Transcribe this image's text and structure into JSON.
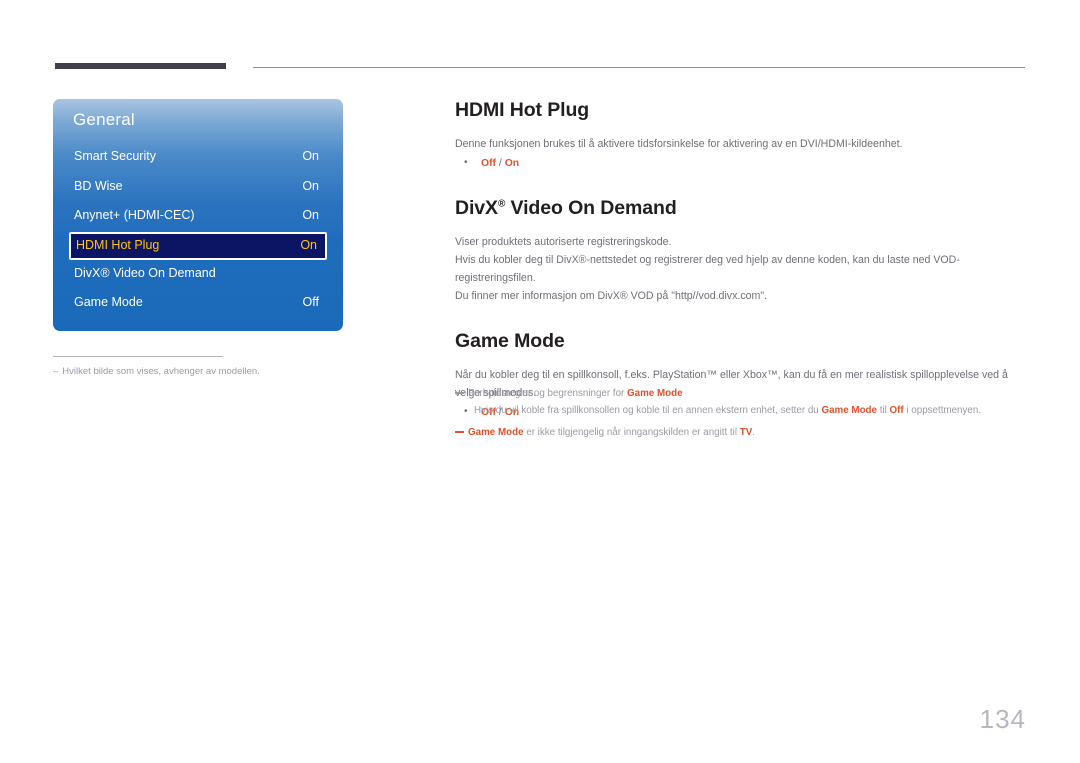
{
  "header": {
    "rule_thick": "decorative-dark-bar",
    "rule_thin": "decorative-thin-line"
  },
  "osd": {
    "title": "General",
    "items": [
      {
        "label": "Smart Security",
        "value": "On",
        "selected": false
      },
      {
        "label": "BD Wise",
        "value": "On",
        "selected": false
      },
      {
        "label": "Anynet+ (HDMI-CEC)",
        "value": "On",
        "selected": false
      },
      {
        "label": "HDMI Hot Plug",
        "value": "On",
        "selected": true
      },
      {
        "label": "DivX® Video On Demand",
        "value": "",
        "selected": false
      },
      {
        "label": "Game Mode",
        "value": "Off",
        "selected": false
      }
    ],
    "footnote_dash": "–",
    "footnote": "Hvilket bilde som vises, avhenger av modellen."
  },
  "article": {
    "sections": [
      {
        "heading": "HDMI Hot Plug",
        "heading_sup": "",
        "paragraphs": [
          "Denne funksjonen brukes til å aktivere tidsforsinkelse for aktivering av en DVI/HDMI-kildeenhet."
        ],
        "options": {
          "first": "Off",
          "separator": " / ",
          "second": "On"
        }
      },
      {
        "heading": "DivX",
        "heading_sup": "®",
        "heading_rest": " Video On Demand",
        "paragraphs": [
          "Viser produktets autoriserte registreringskode.",
          "Hvis du kobler deg til DivX®-nettstedet og registrerer deg ved hjelp av denne koden, kan du laste ned VOD-registreringsfilen.",
          "Du finner mer informasjon om DivX® VOD på \"http//vod.divx.com\"."
        ],
        "options": null
      },
      {
        "heading": "Game Mode",
        "heading_sup": "",
        "paragraphs": [
          "Når du kobler deg til en spillkonsoll, f.eks. PlayStation™ eller Xbox™, kan du få en mer realistisk spillopplevelse ved å velge spillmodus."
        ],
        "options": {
          "first": "Off",
          "separator": " / ",
          "second": "On"
        }
      }
    ]
  },
  "notes": {
    "note1_pre": "Forholdsregler og begrensninger for ",
    "note1_hl": "Game Mode",
    "note1_sub_a": "Hvis du  vil koble fra spillkonsollen og koble til en annen ekstern enhet, setter du ",
    "note1_sub_hl1": "Game Mode",
    "note1_sub_b": " til ",
    "note1_sub_hl2": "Off",
    "note1_sub_c": " i oppsettmenyen.",
    "note2_hl1": "Game Mode",
    "note2_mid": " er ikke tilgjengelig når inngangskilden er angitt til ",
    "note2_hl2": "TV",
    "note2_end": "."
  },
  "footer": {
    "page_number": "134"
  },
  "colors": {
    "accent_orange": "#e2512c",
    "osd_blue_top": "#a9c5e1",
    "osd_blue_bottom": "#1b6ab9",
    "osd_selected_bg": "#0c1464",
    "osd_selected_text": "#ffc40d",
    "body_text": "#6f6f78",
    "heading_text": "#231f20",
    "note_text": "#9a9aa5",
    "page_number": "#b7b7c4",
    "rule_dark": "#413e4b"
  }
}
